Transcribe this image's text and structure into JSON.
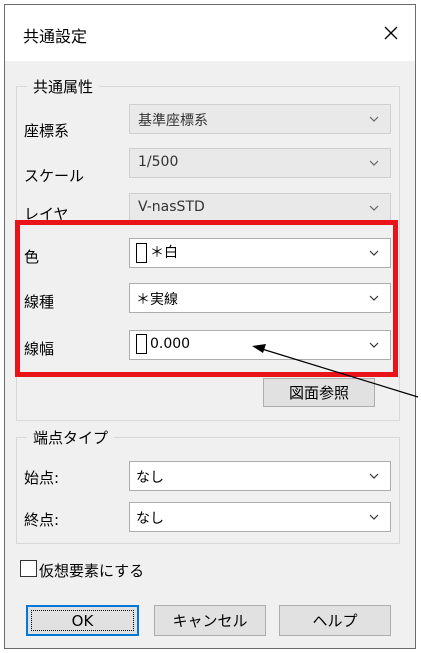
{
  "dialog": {
    "title": "共通設定"
  },
  "common": {
    "group_title": "共通属性",
    "coord": {
      "label": "座標系",
      "value": "基準座標系"
    },
    "scale": {
      "label": "スケール",
      "value": "1/500"
    },
    "layer": {
      "label": "レイヤ",
      "value": "V-nasSTD"
    },
    "color": {
      "label": "色",
      "value": "＊白"
    },
    "linetype": {
      "label": "線種",
      "value": "＊実線"
    },
    "linewidth": {
      "label": "線幅",
      "value": "0.000"
    },
    "drawing_ref_button": "図面参照"
  },
  "endpoint": {
    "group_title": "端点タイプ",
    "start": {
      "label": "始点:",
      "value": "なし"
    },
    "end": {
      "label": "終点:",
      "value": "なし"
    }
  },
  "virtual_checkbox": {
    "label": "仮想要素にする",
    "checked": false
  },
  "buttons": {
    "ok": "OK",
    "cancel": "キャンセル",
    "help": "ヘルプ"
  },
  "annotation": {
    "highlight_color": "#e8141a"
  },
  "icons": {
    "close": "close-icon",
    "dropdown": "chevron-down-icon"
  }
}
